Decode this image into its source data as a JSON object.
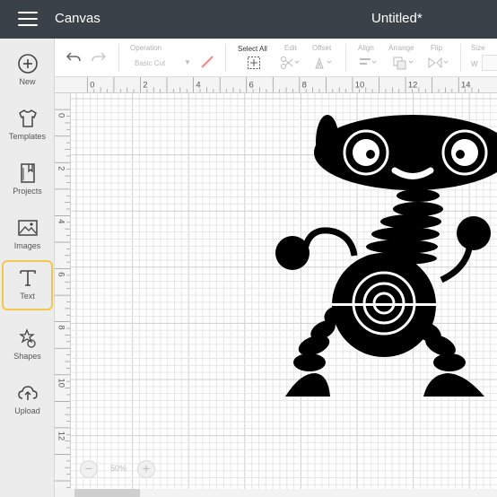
{
  "header": {
    "menu_icon": "hamburger-menu-icon",
    "title": "Canvas",
    "document_title": "Untitled*"
  },
  "sidebar": {
    "items": [
      {
        "label": "New",
        "icon": "plus-circle-icon"
      },
      {
        "label": "Templates",
        "icon": "shirt-icon"
      },
      {
        "label": "Projects",
        "icon": "bookmark-book-icon"
      },
      {
        "label": "Images",
        "icon": "image-icon"
      },
      {
        "label": "Text",
        "icon": "text-t-icon",
        "active": true
      },
      {
        "label": "Shapes",
        "icon": "shapes-icon"
      },
      {
        "label": "Upload",
        "icon": "cloud-upload-icon"
      }
    ],
    "active_color": "#f2c84b"
  },
  "toolbar": {
    "undo_icon": "undo-icon",
    "redo_icon": "redo-icon",
    "operation_label": "Operation",
    "operation_value": "Basic Cut",
    "select_all_label": "Select All",
    "edit_label": "Edit",
    "offset_label": "Offset",
    "align_label": "Align",
    "arrange_label": "Arrange",
    "flip_label": "Flip",
    "size_label": "Size",
    "width_label": "W",
    "pen_color": "#f08a8a"
  },
  "rulers": {
    "top_ticks": [
      "0",
      "2",
      "4",
      "6",
      "8",
      "10",
      "12",
      "14"
    ],
    "left_ticks": [
      "0",
      "2",
      "4",
      "6",
      "8",
      "10",
      "12"
    ]
  },
  "zoom": {
    "minus": "−",
    "value": "50%",
    "plus": "+"
  },
  "canvas": {
    "grid_color": "#e6e6e6",
    "major_grid_color": "#cfcfcf",
    "figure": "robot-image"
  },
  "colors": {
    "header_bg": "#3a4148",
    "sidebar_bg": "#ececec"
  }
}
